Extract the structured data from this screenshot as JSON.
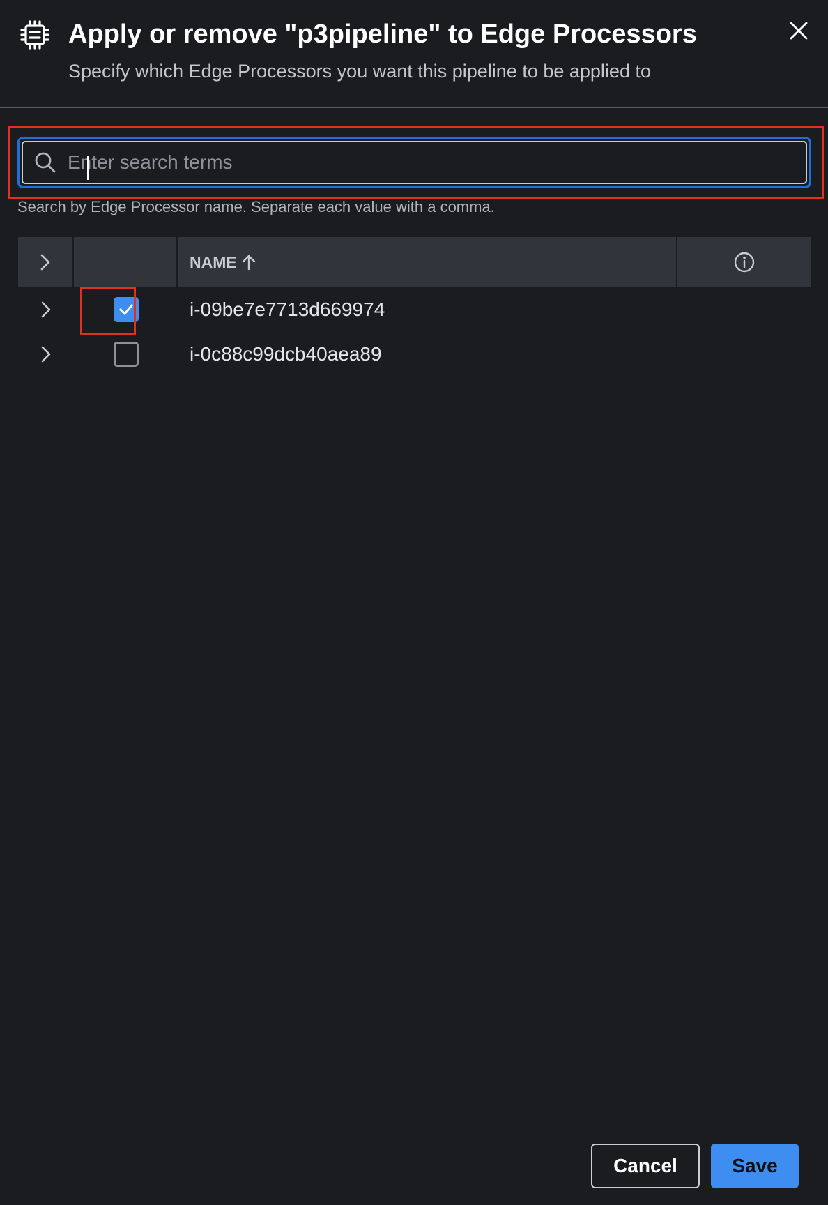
{
  "dialog": {
    "title": "Apply or remove \"p3pipeline\" to Edge Processors",
    "subtitle": "Specify which Edge Processors you want this pipeline to be applied to",
    "header_icon": "processor-chip-icon",
    "close_icon": "close-icon"
  },
  "search": {
    "placeholder": "Enter search terms",
    "value": "",
    "help_text": "Search by Edge Processor name. Separate each value with a comma.",
    "icon": "search-icon"
  },
  "table": {
    "columns": {
      "name_label": "NAME",
      "sort_direction": "ascending",
      "info_icon": "info-icon"
    },
    "rows": [
      {
        "name": "i-09be7e7713d669974",
        "checked": true
      },
      {
        "name": "i-0c88c99dcb40aea89",
        "checked": false
      }
    ]
  },
  "footer": {
    "cancel_label": "Cancel",
    "save_label": "Save"
  },
  "colors": {
    "background": "#1b1c20",
    "accent": "#3d8ef0",
    "highlight": "#e0301e",
    "focus_ring": "#1e6fd9"
  }
}
